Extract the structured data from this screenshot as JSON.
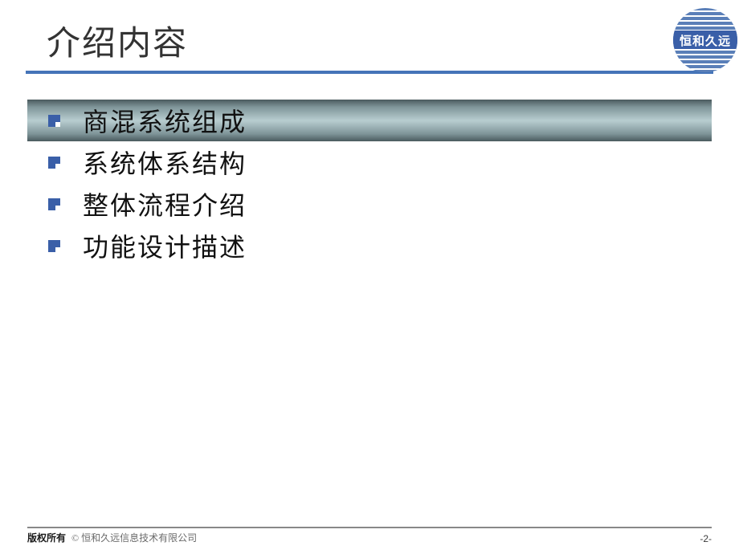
{
  "title": "介绍内容",
  "logo": {
    "text": "恒和久远"
  },
  "items": [
    {
      "label": "商混系统组成",
      "highlight": true
    },
    {
      "label": "系统体系结构",
      "highlight": false
    },
    {
      "label": "整体流程介绍",
      "highlight": false
    },
    {
      "label": "功能设计描述",
      "highlight": false
    }
  ],
  "footer": {
    "copyright_label": "版权所有",
    "copyright_symbol": "©",
    "company": "恒和久远信息技术有限公司",
    "page": "-2-"
  },
  "colors": {
    "accent": "#4574b8",
    "bullet": "#3a5fa8"
  }
}
